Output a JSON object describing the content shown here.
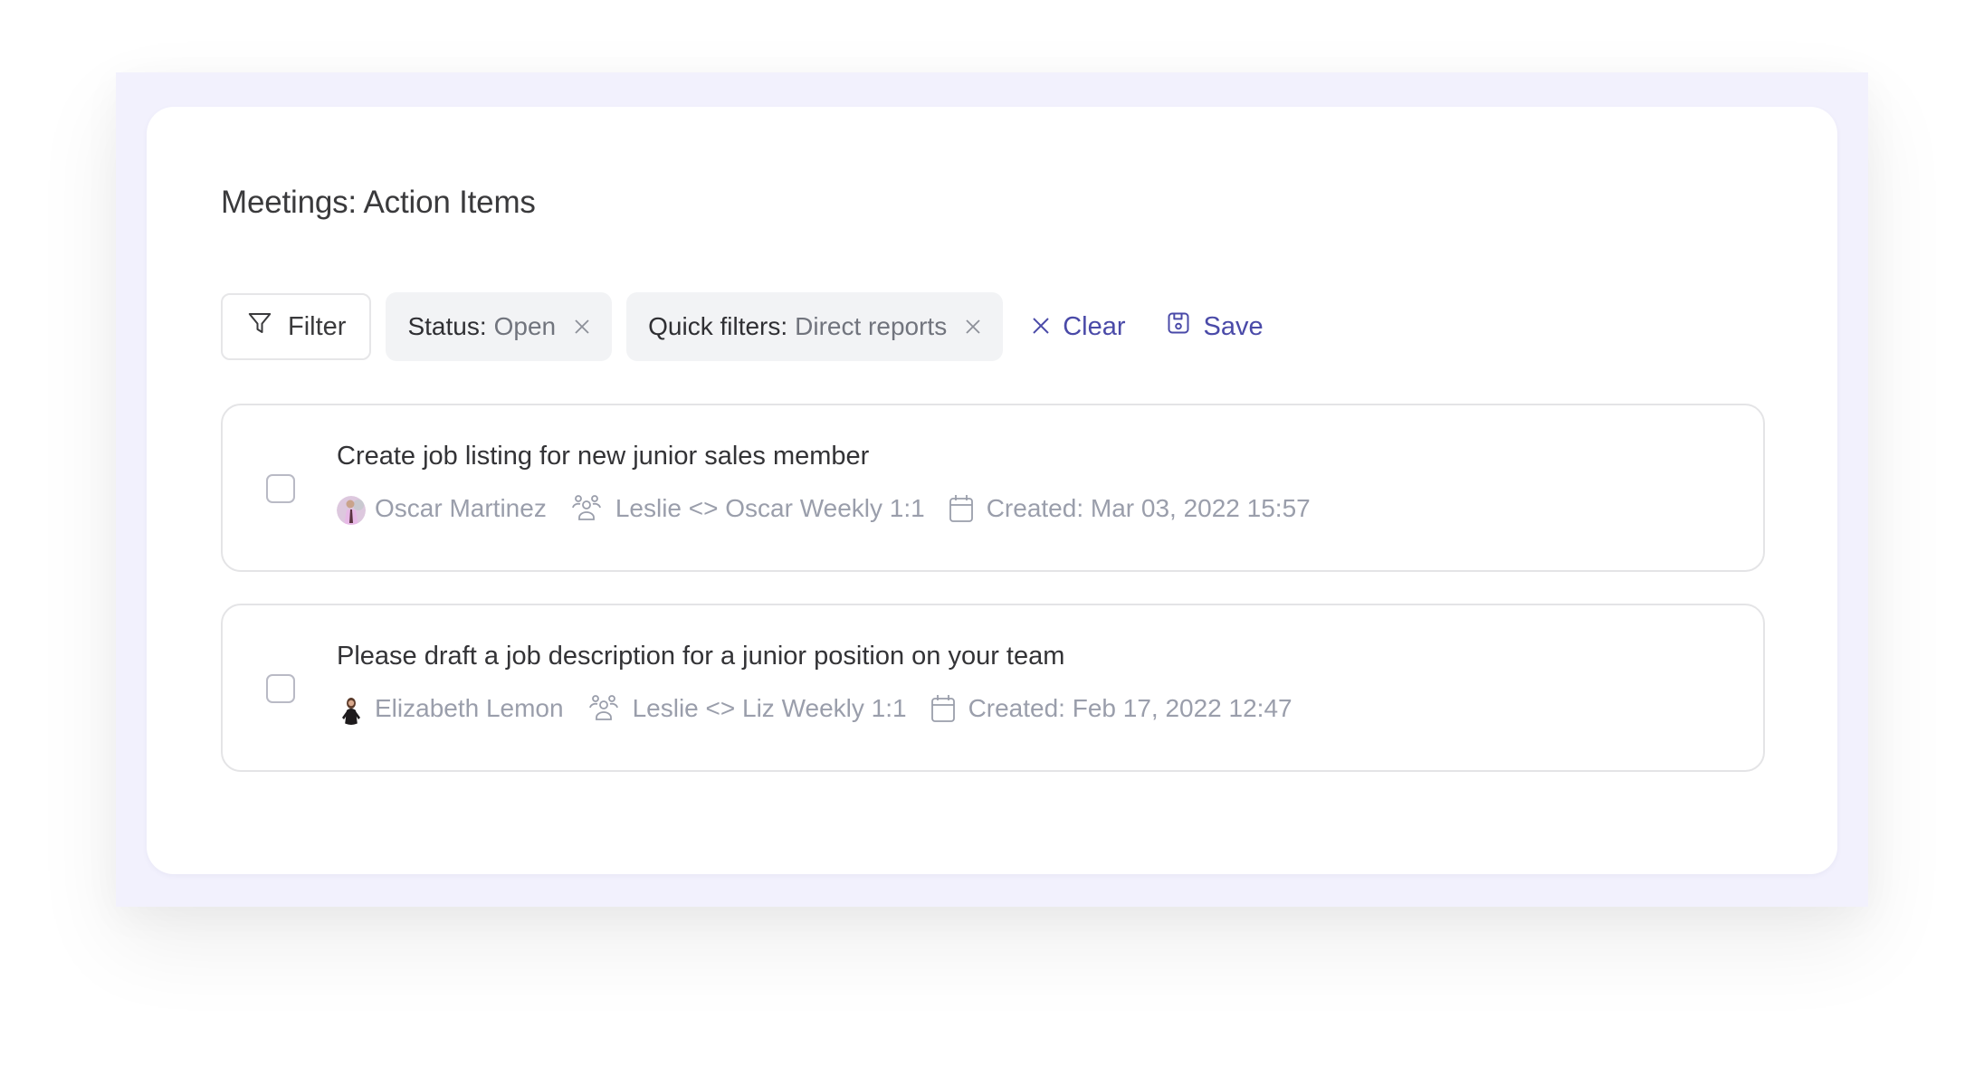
{
  "page": {
    "title": "Meetings: Action Items"
  },
  "toolbar": {
    "filter_label": "Filter",
    "chips": [
      {
        "key": "Status:",
        "value": "Open"
      },
      {
        "key": "Quick filters:",
        "value": "Direct reports"
      }
    ],
    "clear_label": "Clear",
    "save_label": "Save"
  },
  "action_items": [
    {
      "title": "Create job listing for new junior sales member",
      "checked": false,
      "assignee": "Oscar Martinez",
      "meeting": "Leslie <> Oscar Weekly 1:1",
      "created": "Created: Mar 03, 2022 15:57"
    },
    {
      "title": "Please draft a job description for a junior position on your team",
      "checked": false,
      "assignee": "Elizabeth Lemon",
      "meeting": "Leslie <> Liz Weekly 1:1",
      "created": "Created: Feb 17, 2022 12:47"
    }
  ],
  "colors": {
    "accent": "#4a4aa8",
    "frame": "#f2f1fd",
    "chip_bg": "#f2f3f5",
    "meta_text": "#9a9eab"
  },
  "icons": {
    "filter": "funnel-icon",
    "remove": "close-icon",
    "clear": "close-icon",
    "save": "floppy-disk-icon",
    "meeting": "people-group-icon",
    "created": "calendar-icon"
  }
}
